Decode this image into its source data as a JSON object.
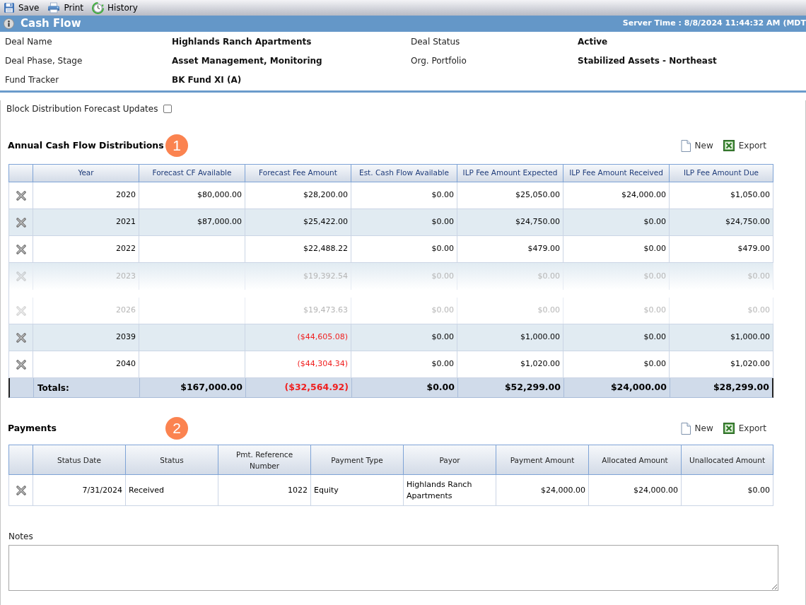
{
  "toolbar": [
    {
      "label": "Save"
    },
    {
      "label": "Print"
    },
    {
      "label": "History"
    }
  ],
  "header": {
    "title": "Cash Flow",
    "server_time": "Server Time : 8/8/2024 11:44:32 AM (MDT"
  },
  "details": [
    {
      "label": "Deal Name",
      "value": "Highlands Ranch Apartments"
    },
    {
      "label": "Deal Status",
      "value": "Active"
    },
    {
      "label": "Deal Phase, Stage",
      "value": "Asset Management, Monitoring"
    },
    {
      "label": "Org. Portfolio",
      "value": "Stabilized Assets - Northeast"
    },
    {
      "label": "Fund Tracker",
      "value": "BK Fund XI (A)"
    }
  ],
  "block_updates": {
    "label": "Block Distribution Forecast Updates",
    "checked": false
  },
  "distributions": {
    "title": "Annual Cash Flow Distributions",
    "marker": "1",
    "actions": [
      {
        "label": "New"
      },
      {
        "label": "Export"
      }
    ],
    "columns": [
      "Year",
      "Forecast CF Available",
      "Forecast Fee Amount",
      "Est. Cash Flow Available",
      "ILP Fee Amount Expected",
      "ILP Fee Amount Received",
      "ILP Fee Amount Due"
    ],
    "rows": [
      {
        "kind": "row",
        "cells": [
          {
            "text": "2020",
            "negative": false
          },
          {
            "text": "$80,000.00",
            "negative": false
          },
          {
            "text": "$28,200.00",
            "negative": false
          },
          {
            "text": "$0.00",
            "negative": false
          },
          {
            "text": "$25,050.00",
            "negative": false
          },
          {
            "text": "$24,000.00",
            "negative": false
          },
          {
            "text": "$1,050.00",
            "negative": false
          }
        ]
      },
      {
        "kind": "row",
        "cells": [
          {
            "text": "2021",
            "negative": false
          },
          {
            "text": "$87,000.00",
            "negative": false
          },
          {
            "text": "$25,422.00",
            "negative": false
          },
          {
            "text": "$0.00",
            "negative": false
          },
          {
            "text": "$24,750.00",
            "negative": false
          },
          {
            "text": "$0.00",
            "negative": false
          },
          {
            "text": "$24,750.00",
            "negative": false
          }
        ]
      },
      {
        "kind": "row",
        "cells": [
          {
            "text": "2022",
            "negative": false
          },
          null,
          {
            "text": "$22,488.22",
            "negative": false
          },
          {
            "text": "$0.00",
            "negative": false
          },
          {
            "text": "$479.00",
            "negative": false
          },
          {
            "text": "$0.00",
            "negative": false
          },
          {
            "text": "$479.00",
            "negative": false
          }
        ]
      },
      {
        "kind": "fade-out",
        "cells": [
          {
            "text": "2023",
            "negative": false
          },
          null,
          {
            "text": "$19,392.54",
            "negative": false
          },
          {
            "text": "$0.00",
            "negative": false
          },
          {
            "text": "$0.00",
            "negative": false
          },
          {
            "text": "$0.00",
            "negative": false
          },
          {
            "text": "$0.00",
            "negative": false
          }
        ]
      },
      {
        "kind": "fade-in",
        "cells": [
          {
            "text": "2026",
            "negative": false
          },
          null,
          {
            "text": "$19,473.63",
            "negative": false
          },
          {
            "text": "$0.00",
            "negative": false
          },
          {
            "text": "$0.00",
            "negative": false
          },
          {
            "text": "$0.00",
            "negative": false
          },
          {
            "text": "$0.00",
            "negative": false
          }
        ]
      },
      {
        "kind": "row",
        "cells": [
          {
            "text": "2039",
            "negative": false
          },
          null,
          {
            "text": "($44,605.08)",
            "negative": true
          },
          {
            "text": "$0.00",
            "negative": false
          },
          {
            "text": "$1,000.00",
            "negative": false
          },
          {
            "text": "$0.00",
            "negative": false
          },
          {
            "text": "$1,000.00",
            "negative": false
          }
        ]
      },
      {
        "kind": "row",
        "cells": [
          {
            "text": "2040",
            "negative": false
          },
          null,
          {
            "text": "($44,304.34)",
            "negative": true
          },
          {
            "text": "$0.00",
            "negative": false
          },
          {
            "text": "$1,020.00",
            "negative": false
          },
          {
            "text": "$0.00",
            "negative": false
          },
          {
            "text": "$1,020.00",
            "negative": false
          }
        ]
      }
    ],
    "totals": {
      "label": "Totals:",
      "cells": [
        {
          "text": "$167,000.00",
          "negative": false
        },
        {
          "text": "($32,564.92)",
          "negative": true
        },
        {
          "text": "$0.00",
          "negative": false
        },
        {
          "text": "$52,299.00",
          "negative": false
        },
        {
          "text": "$24,000.00",
          "negative": false
        },
        {
          "text": "$28,299.00",
          "negative": false
        }
      ]
    }
  },
  "payments": {
    "title": "Payments",
    "marker": "2",
    "actions": [
      {
        "label": "New"
      },
      {
        "label": "Export"
      }
    ],
    "columns": [
      "Status Date",
      "Status",
      "Pmt. Reference Number",
      "Payment Type",
      "Payor",
      "Payment Amount",
      "Allocated Amount",
      "Unallocated Amount"
    ],
    "rows": [
      {
        "cells": [
          "7/31/2024",
          "Received",
          "1022",
          "Equity",
          "Highlands Ranch Apartments",
          "$24,000.00",
          "$24,000.00",
          "$0.00"
        ]
      }
    ]
  },
  "notes": {
    "label": "Notes"
  }
}
